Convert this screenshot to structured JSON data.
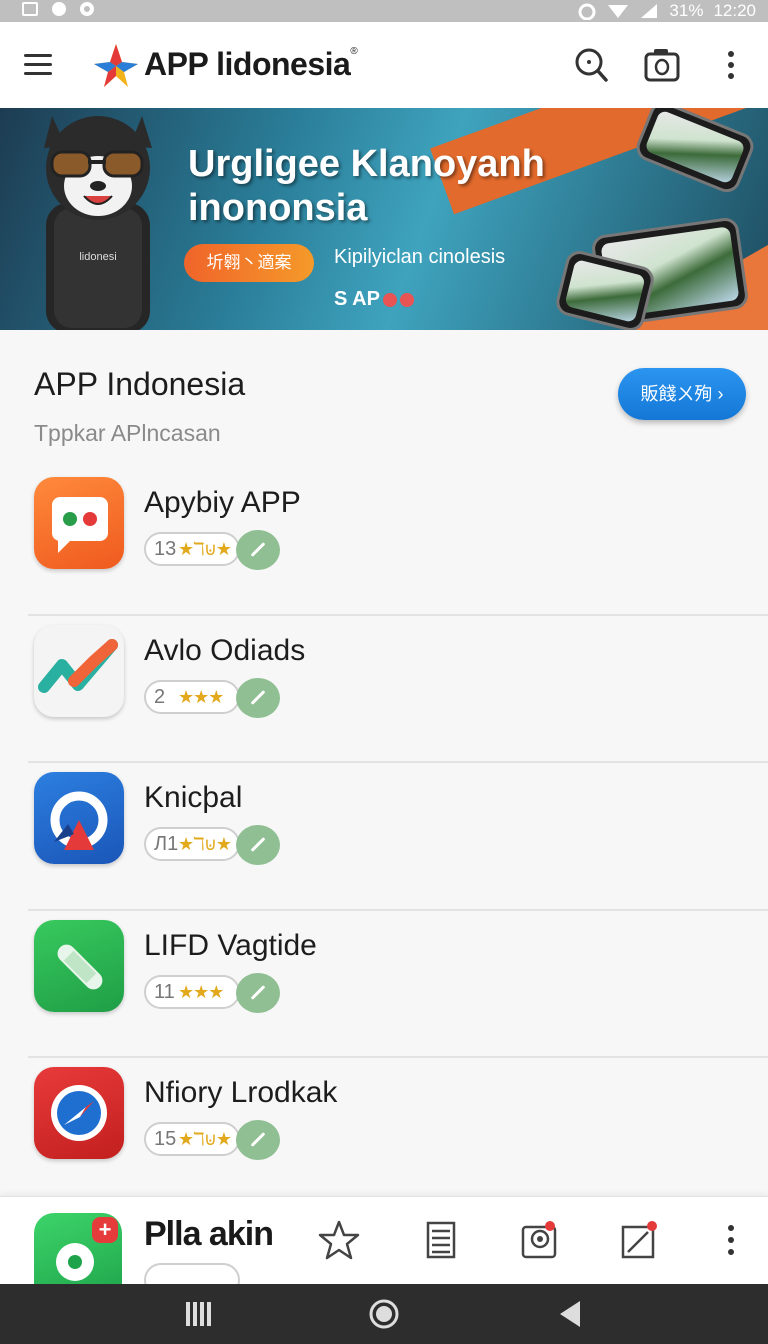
{
  "status_bar": {
    "battery": "31%",
    "time": "12:20"
  },
  "app_bar": {
    "title": "APP lidonesia",
    "title_mark": "®",
    "icons": [
      "menu-icon",
      "search-icon",
      "camera-icon",
      "more-vert-icon"
    ]
  },
  "banner": {
    "headline_line1": "Urgligee Klanoyanh",
    "headline_line2": "inononsia",
    "pill_label": "圻翱丶適案",
    "tagline": "Kipilyiclan cinolesis",
    "brand": "S AP",
    "mascot_label": "lidonesi"
  },
  "section": {
    "title": "APP Indonesia",
    "subtitle": "Tppkar APlncasan",
    "more_button": "販餞ㄨ殉 ›"
  },
  "apps": [
    {
      "name": "Apybiy APP",
      "rating_count": "13",
      "stars": "★ℸ⊍★",
      "icon": "chat-icon"
    },
    {
      "name": "Avlo Odiads",
      "rating_count": "2",
      "stars": "★★★",
      "icon": "trend-chart-icon"
    },
    {
      "name": "Knicþal",
      "rating_count": "Л1",
      "stars": "★ℸ⊍★",
      "icon": "gauge-icon"
    },
    {
      "name": "LIFD Vagtide",
      "rating_count": "11",
      "stars": "★★★",
      "icon": "bandage-icon"
    },
    {
      "name": "Nfiory Lrodkak",
      "rating_count": "15",
      "stars": "★ℸ⊍★",
      "icon": "compass-icon"
    }
  ],
  "bottom_bar": {
    "title": "Plla akin",
    "icons": [
      "star-icon",
      "library-icon",
      "profile-icon",
      "edit-icon",
      "more-vert-icon"
    ]
  },
  "colors": {
    "accent_blue": "#1a82e0",
    "banner_orange": "#e26a2c",
    "download_green": "#8fbf92"
  }
}
